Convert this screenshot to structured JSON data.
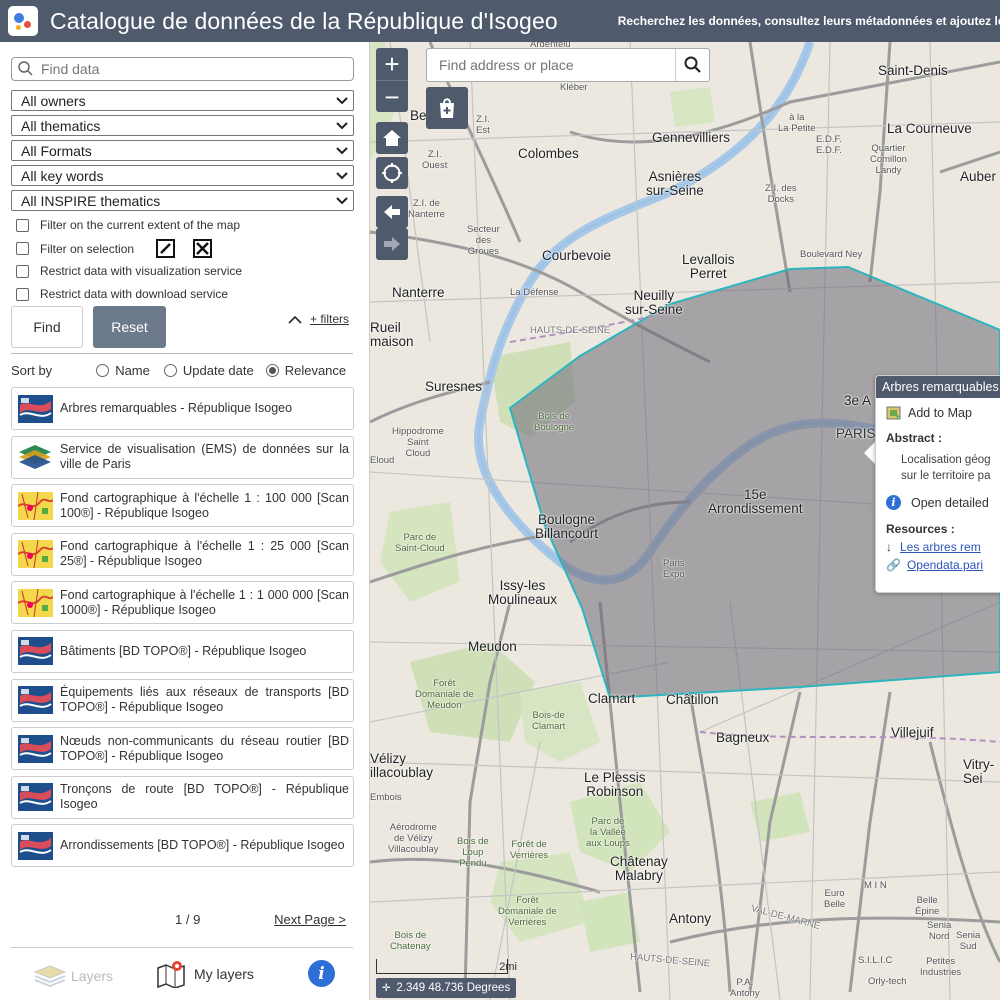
{
  "header": {
    "title": "Catalogue de données de la République d'Isogeo",
    "subtitle": "Recherchez les données, consultez leurs métadonnées et ajoutez les à la"
  },
  "sidebar": {
    "search_placeholder": "Find data",
    "selects": [
      {
        "value": "All owners"
      },
      {
        "value": "All thematics"
      },
      {
        "value": "All Formats"
      },
      {
        "value": "All key words"
      },
      {
        "value": "All INSPIRE thematics"
      }
    ],
    "checks": [
      "Filter on the current extent of the map",
      "Filter on selection",
      "Restrict data with visualization service",
      "Restrict data with download service"
    ],
    "find_label": "Find",
    "reset_label": "Reset",
    "filters_link": "+ filters",
    "sort": {
      "label": "Sort by",
      "options": [
        "Name",
        "Update date",
        "Relevance"
      ],
      "selected": "Relevance"
    },
    "results": [
      {
        "title": "Arbres remarquables - République Isogeo",
        "thumb": "vector"
      },
      {
        "title": "Service de visualisation (EMS) de données sur la ville de Paris",
        "thumb": "service"
      },
      {
        "title": "Fond cartographique à l'échelle 1 : 100 000 [Scan 100®] - République Isogeo",
        "thumb": "raster"
      },
      {
        "title": "Fond cartographique à l'échelle 1 : 25 000 [Scan 25®] - République Isogeo",
        "thumb": "raster"
      },
      {
        "title": "Fond cartographique à l'échelle 1 : 1 000 000 [Scan 1000®] - République Isogeo",
        "thumb": "raster"
      },
      {
        "title": "Bâtiments [BD TOPO®] - République Isogeo",
        "thumb": "vector"
      },
      {
        "title": "Équipements liés aux réseaux de transports [BD TOPO®] - République Isogeo",
        "thumb": "vector"
      },
      {
        "title": "Nœuds non-communicants du réseau routier [BD TOPO®] - République Isogeo",
        "thumb": "vector"
      },
      {
        "title": "Tronçons de route [BD TOPO®] - République Isogeo",
        "thumb": "vector"
      },
      {
        "title": "Arrondissements [BD TOPO®] - République Isogeo",
        "thumb": "vector"
      }
    ],
    "pager": {
      "current": "1 / 9",
      "next": "Next Page >"
    },
    "bottom": {
      "layers": "Layers",
      "my_layers": "My layers"
    }
  },
  "map": {
    "address_placeholder": "Find address or place",
    "popup": {
      "title": "Arbres remarquables",
      "add_to_map": "Add to Map",
      "abstract_label": "Abstract :",
      "abstract_line1": "Localisation géog",
      "abstract_line2": "sur le territoire pa",
      "open_detailed": "Open detailed",
      "resources_label": "Resources :",
      "res1": "Les arbres rem",
      "res2": "Opendata.pari"
    },
    "scale_label": "2mi",
    "coords": "2.349 48.736 Degrees",
    "places": {
      "saint_denis": "Saint-Denis",
      "la_courneuve": "La Courneuve",
      "aubervilliers": "Auber",
      "gennevilliers": "Gennevilliers",
      "colombes": "Colombes",
      "asnieres": "Asnières\nsur-Seine",
      "zi_docks": "Z.I. des\nDocks",
      "courbevoie": "Courbevoie",
      "levallois": "Levallois\nPerret",
      "boulevard_ney": "Boulevard Ney",
      "nanterre": "Nanterre",
      "la_defense": "La Défense",
      "neuilly": "Neuilly\nsur-Seine",
      "rueil": "Rueil\nmaison",
      "suresnes": "Suresnes",
      "hauts_de_seine": "HAUTS-DE-SEINE",
      "bois_boulogne": "Bois de\nBoulogne",
      "paris": "PARIS",
      "troisieme": "3e A",
      "quinzieme": "15e\nArrondissement",
      "boulogne": "Boulogne\nBillancourt",
      "paris_expo": "Paris\nExpo",
      "issy": "Issy-les\nMoulineaux",
      "meudon": "Meudon",
      "foret_meudon": "Forêt\nDomaniale de\nMeudon",
      "bois_clamart": "Bois-de\nClamart",
      "clamart": "Clamart",
      "chatillon": "Châtillon",
      "bagneux": "Bagneux",
      "villejuif": "Villejuif",
      "vitry": "Vitry-\nSei",
      "velizy": "Vélizy\nillacoublay",
      "le_plessis": "Le Plessis\nRobinson",
      "parc_vallee": "Parc de\nla Vallée\naux Loups",
      "chatenay": "Châtenay\nMalabry",
      "foret_verrieres": "Forêt\nDomaniale de\nVerrières",
      "antony": "Antony",
      "min": "M I N",
      "hippodrome": "Hippodrome\nSaint\nCloud",
      "parc_stcloud": "Parc de\nSaint-Cloud",
      "zi_ouest": "Z.I.\nOuest",
      "zi_nanterre": "Z.I. de\nNanterre",
      "est": "Z.I.\nEst",
      "secteur_groues": "Secteur\ndes\nGroues",
      "bois_chatenay": "Bois de\nChatenay",
      "aerodrome": "Aérodrome\nde Vélizy\nVillacoublay",
      "bois_loup": "Bois de\nLoup\nPendu",
      "foret_verrieres2": "Forêt de\nVerrières",
      "embois": "Embois",
      "val_de_marne": "VAL-DE-MARNE",
      "hauts_de_seine2": "HAUTS-DE-SEINE",
      "petites_industries": "Petites\nIndustries",
      "senia": "Senia\nNord",
      "senia2": "Senia\nSud",
      "belle_epine": "Belle\nÉpine",
      "euro_belle": "Euro\nBelle",
      "silic": "S.I.L.I.C",
      "orly": "Orly-tech",
      "pa_antony": "P.A.\nAntony",
      "quartier_comm": "Quartier\nComillon\nLandy",
      "la_petite": "à la\nLa Petite",
      "la_petite2": "à la\nla Petite",
      "edf": "E.D.F.\nE.D.F.",
      "ardentelu": "Ardentelu",
      "kleber": "Kléber",
      "be": "Be",
      "ile": "Z.I.\nEst",
      "eloud": "Eloud",
      "ruei": "Ruei"
    }
  }
}
